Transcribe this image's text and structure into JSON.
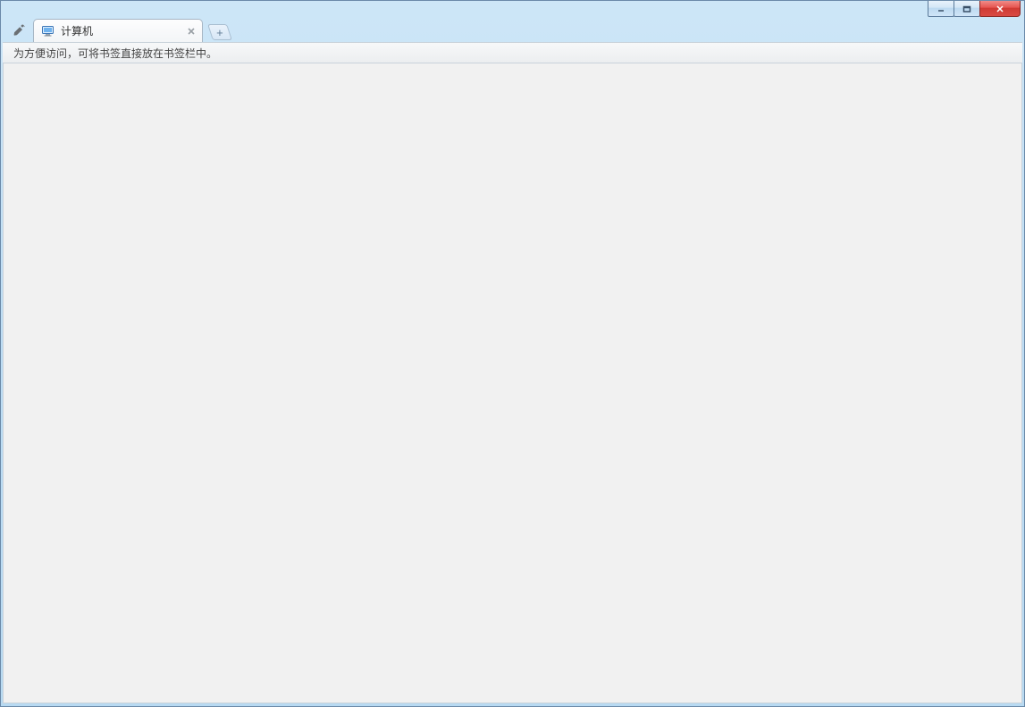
{
  "window": {
    "controls": {
      "minimize": "minimize",
      "maximize": "maximize",
      "close": "close"
    }
  },
  "tabs": [
    {
      "title": "计算机",
      "favicon": "computer-icon"
    }
  ],
  "new_tab": {
    "symbol": "+"
  },
  "bookmark_bar": {
    "message": "为方便访问，可将书签直接放在书签栏中。"
  },
  "colors": {
    "frame_top": "#cde6f7",
    "close_red": "#d84a43",
    "content_bg": "#f1f1f1"
  }
}
